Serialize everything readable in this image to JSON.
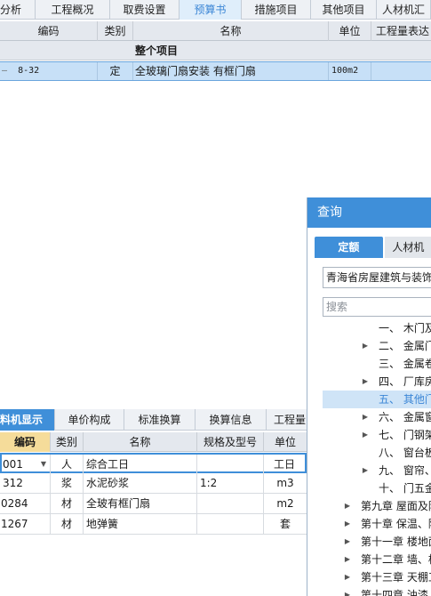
{
  "top_tabs": [
    "分析",
    "工程概况",
    "取费设置",
    "预算书",
    "措施项目",
    "其他项目",
    "人材机汇"
  ],
  "top_active": "预算书",
  "grid": {
    "headers": [
      "编码",
      "类别",
      "名称",
      "单位",
      "工程量表达"
    ],
    "total_row_label": "整个项目",
    "item_row": {
      "code": "8-32",
      "type": "定",
      "name": "全玻璃门扇安装 有框门扇",
      "unit": "100m2",
      "qty_expr": ""
    }
  },
  "bottom": {
    "tabs": [
      "料机显示",
      "单价构成",
      "标准换算",
      "换算信息",
      "工程量"
    ],
    "headers": [
      "编码",
      "类别",
      "名称",
      "规格及型号",
      "单位"
    ],
    "rows": [
      {
        "code": "001",
        "type": "人",
        "name": "综合工日",
        "spec": "",
        "unit": "工日"
      },
      {
        "code": "312",
        "type": "浆",
        "name": "水泥砂浆",
        "spec": "1:2",
        "unit": "m3"
      },
      {
        "code": "0284",
        "type": "材",
        "name": "全玻有框门扇",
        "spec": "",
        "unit": "m2"
      },
      {
        "code": "1267",
        "type": "材",
        "name": "地弹簧",
        "spec": "",
        "unit": "套"
      }
    ]
  },
  "query": {
    "title": "查询",
    "tabs": [
      "定额",
      "人材机"
    ],
    "library": "青海省房屋建筑与装饰",
    "search_placeholder": "搜索",
    "tree": [
      {
        "label": "一、 木门及",
        "arrow": false,
        "sel": false,
        "indent": 2
      },
      {
        "label": "二、 金属门",
        "arrow": true,
        "sel": false,
        "indent": 2
      },
      {
        "label": "三、 金属卷",
        "arrow": false,
        "sel": false,
        "indent": 2
      },
      {
        "label": "四、 厂库房",
        "arrow": true,
        "sel": false,
        "indent": 2
      },
      {
        "label": "五、 其他门",
        "arrow": false,
        "sel": true,
        "indent": 2
      },
      {
        "label": "六、 金属窗",
        "arrow": true,
        "sel": false,
        "indent": 2
      },
      {
        "label": "七、 门钢架",
        "arrow": true,
        "sel": false,
        "indent": 2
      },
      {
        "label": "八、 窗台板",
        "arrow": false,
        "sel": false,
        "indent": 2
      },
      {
        "label": "九、 窗帘、",
        "arrow": true,
        "sel": false,
        "indent": 2
      },
      {
        "label": "十、 门五金",
        "arrow": false,
        "sel": false,
        "indent": 2
      },
      {
        "label": "第九章 屋面及防",
        "arrow": true,
        "sel": false,
        "indent": 1
      },
      {
        "label": "第十章 保温、隔",
        "arrow": true,
        "sel": false,
        "indent": 1
      },
      {
        "label": "第十一章 楼地面",
        "arrow": true,
        "sel": false,
        "indent": 1
      },
      {
        "label": "第十二章 墙、柱",
        "arrow": true,
        "sel": false,
        "indent": 1
      },
      {
        "label": "第十三章 天棚工",
        "arrow": true,
        "sel": false,
        "indent": 1
      },
      {
        "label": "第十四章 油漆、",
        "arrow": true,
        "sel": false,
        "indent": 1
      }
    ]
  },
  "colors": {
    "accent": "#3f8fd9",
    "selection": "#c7e0f7",
    "header": "#e4e8ee",
    "code_header": "#f5dc9a"
  }
}
